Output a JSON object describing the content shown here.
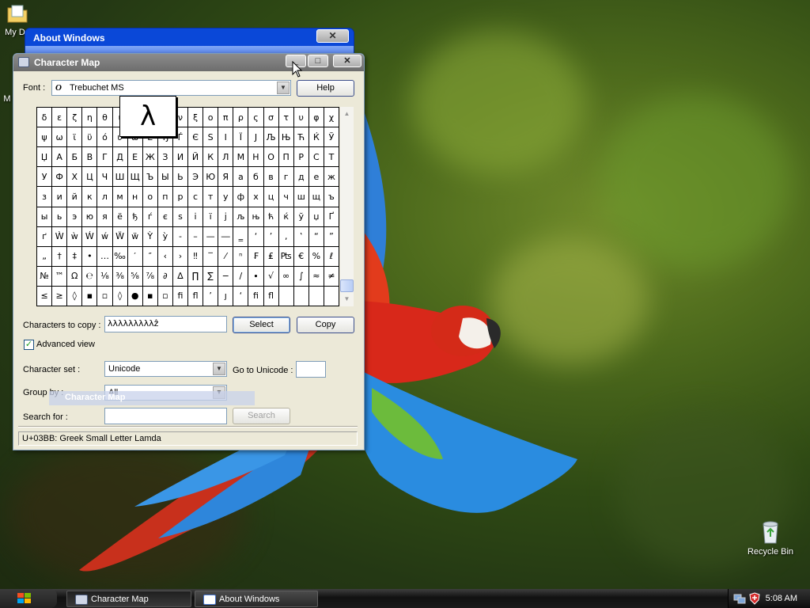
{
  "desktop": {
    "icons": [
      {
        "label": "My Do",
        "icon": "my-documents-icon"
      },
      {
        "label": "M",
        "icon": "my-computer-icon"
      },
      {
        "label": "Recycle Bin",
        "icon": "recycle-bin-icon"
      }
    ]
  },
  "about_window": {
    "title": "About Windows",
    "close": "✕"
  },
  "charmap": {
    "title": "Character Map",
    "buttons": {
      "minimize": "_",
      "maximize": "□",
      "close": "✕"
    },
    "font_label": "Font :",
    "font_value": "Trebuchet MS",
    "font_icon_glyph": "O",
    "help_label": "Help",
    "zoomed_char": "λ",
    "grid": [
      [
        "δ",
        "ε",
        "ζ",
        "η",
        "θ",
        "ι",
        "κ",
        "λ",
        "μ",
        "ν",
        "ξ",
        "ο",
        "π",
        "ρ",
        "ς",
        "σ",
        "τ",
        "υ",
        "φ",
        "χ"
      ],
      [
        "ψ",
        "ω",
        "ϊ",
        "ϋ",
        "ό",
        "ύ",
        "ώ",
        "Ё",
        "Ђ",
        "Ѓ",
        "Є",
        "Ѕ",
        "І",
        "Ї",
        "Ј",
        "Љ",
        "Њ",
        "Ћ",
        "Ќ",
        "Ў"
      ],
      [
        "Џ",
        "А",
        "Б",
        "В",
        "Г",
        "Д",
        "Е",
        "Ж",
        "З",
        "И",
        "Й",
        "К",
        "Л",
        "М",
        "Н",
        "О",
        "П",
        "Р",
        "С",
        "Т"
      ],
      [
        "У",
        "Ф",
        "Х",
        "Ц",
        "Ч",
        "Ш",
        "Щ",
        "Ъ",
        "Ы",
        "Ь",
        "Э",
        "Ю",
        "Я",
        "а",
        "б",
        "в",
        "г",
        "д",
        "е",
        "ж"
      ],
      [
        "з",
        "и",
        "й",
        "к",
        "л",
        "м",
        "н",
        "о",
        "п",
        "р",
        "с",
        "т",
        "у",
        "ф",
        "х",
        "ц",
        "ч",
        "ш",
        "щ",
        "ъ"
      ],
      [
        "ы",
        "ь",
        "э",
        "ю",
        "я",
        "ё",
        "ђ",
        "ѓ",
        "є",
        "ѕ",
        "і",
        "ї",
        "ј",
        "љ",
        "њ",
        "ћ",
        "ќ",
        "ў",
        "џ",
        "Ґ"
      ],
      [
        "ґ",
        "Ẁ",
        "ẁ",
        "Ẃ",
        "ẃ",
        "Ẅ",
        "ẅ",
        "Ỳ",
        "ỳ",
        "‐",
        "–",
        "—",
        "―",
        "‗",
        "‘",
        "’",
        "‚",
        "‛",
        "“",
        "”"
      ],
      [
        "„",
        "†",
        "‡",
        "•",
        "…",
        "‰",
        "′",
        "″",
        "‹",
        "›",
        "‼",
        "‾",
        "⁄",
        "ⁿ",
        "₣",
        "₤",
        "₧",
        "€",
        "%",
        "ℓ"
      ],
      [
        "№",
        "™",
        "Ω",
        "℮",
        "⅛",
        "⅜",
        "⅝",
        "⅞",
        "∂",
        "∆",
        "∏",
        "∑",
        "−",
        "∕",
        "∙",
        "√",
        "∞",
        "∫",
        "≈",
        "≠"
      ],
      [
        "≤",
        "≥",
        "◊",
        "▪",
        "▫",
        "◊",
        "●",
        "▪",
        "▫",
        "ﬁ",
        "ﬂ",
        "’",
        "ȷ",
        "‘",
        "ﬁ",
        "ﬂ",
        "",
        "",
        "",
        ""
      ]
    ],
    "chars_to_copy_label": "Characters to copy :",
    "chars_to_copy_value": "λλλλλλλλλẑ",
    "select_label": "Select",
    "copy_label": "Copy",
    "advanced_view_label": "Advanced view",
    "advanced_view_checked": "✓",
    "charset_label": "Character set :",
    "charset_value": "Unicode",
    "goto_unicode_label": "Go to Unicode :",
    "goto_unicode_value": "",
    "group_label": "Group by :",
    "group_value": "All",
    "search_label": "Search for :",
    "search_value": "",
    "search_button": "Search",
    "status": "U+03BB: Greek Small Letter Lamda",
    "drag_ghost": "Character Map"
  },
  "taskbar": {
    "tasks": [
      {
        "label": "Character Map",
        "active": true
      },
      {
        "label": "About Windows",
        "active": false
      }
    ],
    "clock": "5:08 AM"
  }
}
